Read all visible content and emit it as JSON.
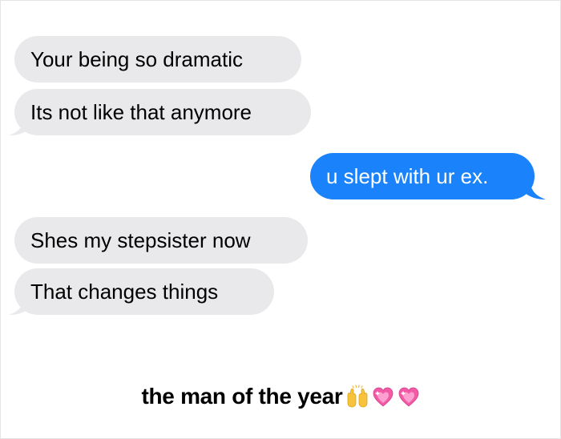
{
  "conversation": {
    "messages": [
      {
        "sender": "other",
        "text": "Your being so dramatic"
      },
      {
        "sender": "other",
        "text": "Its not like that anymore"
      },
      {
        "sender": "me",
        "text": "u slept with ur ex."
      },
      {
        "sender": "other",
        "text": "Shes my stepsister now"
      },
      {
        "sender": "other",
        "text": "That changes things"
      }
    ]
  },
  "caption": {
    "text": "the man of the year",
    "emojis": [
      "raising-hands-icon",
      "sparkling-heart-icon",
      "sparkling-heart-icon"
    ]
  },
  "colors": {
    "received_bubble": "#e9e9eb",
    "sent_bubble": "#1a82fb",
    "background": "#ffffff"
  }
}
